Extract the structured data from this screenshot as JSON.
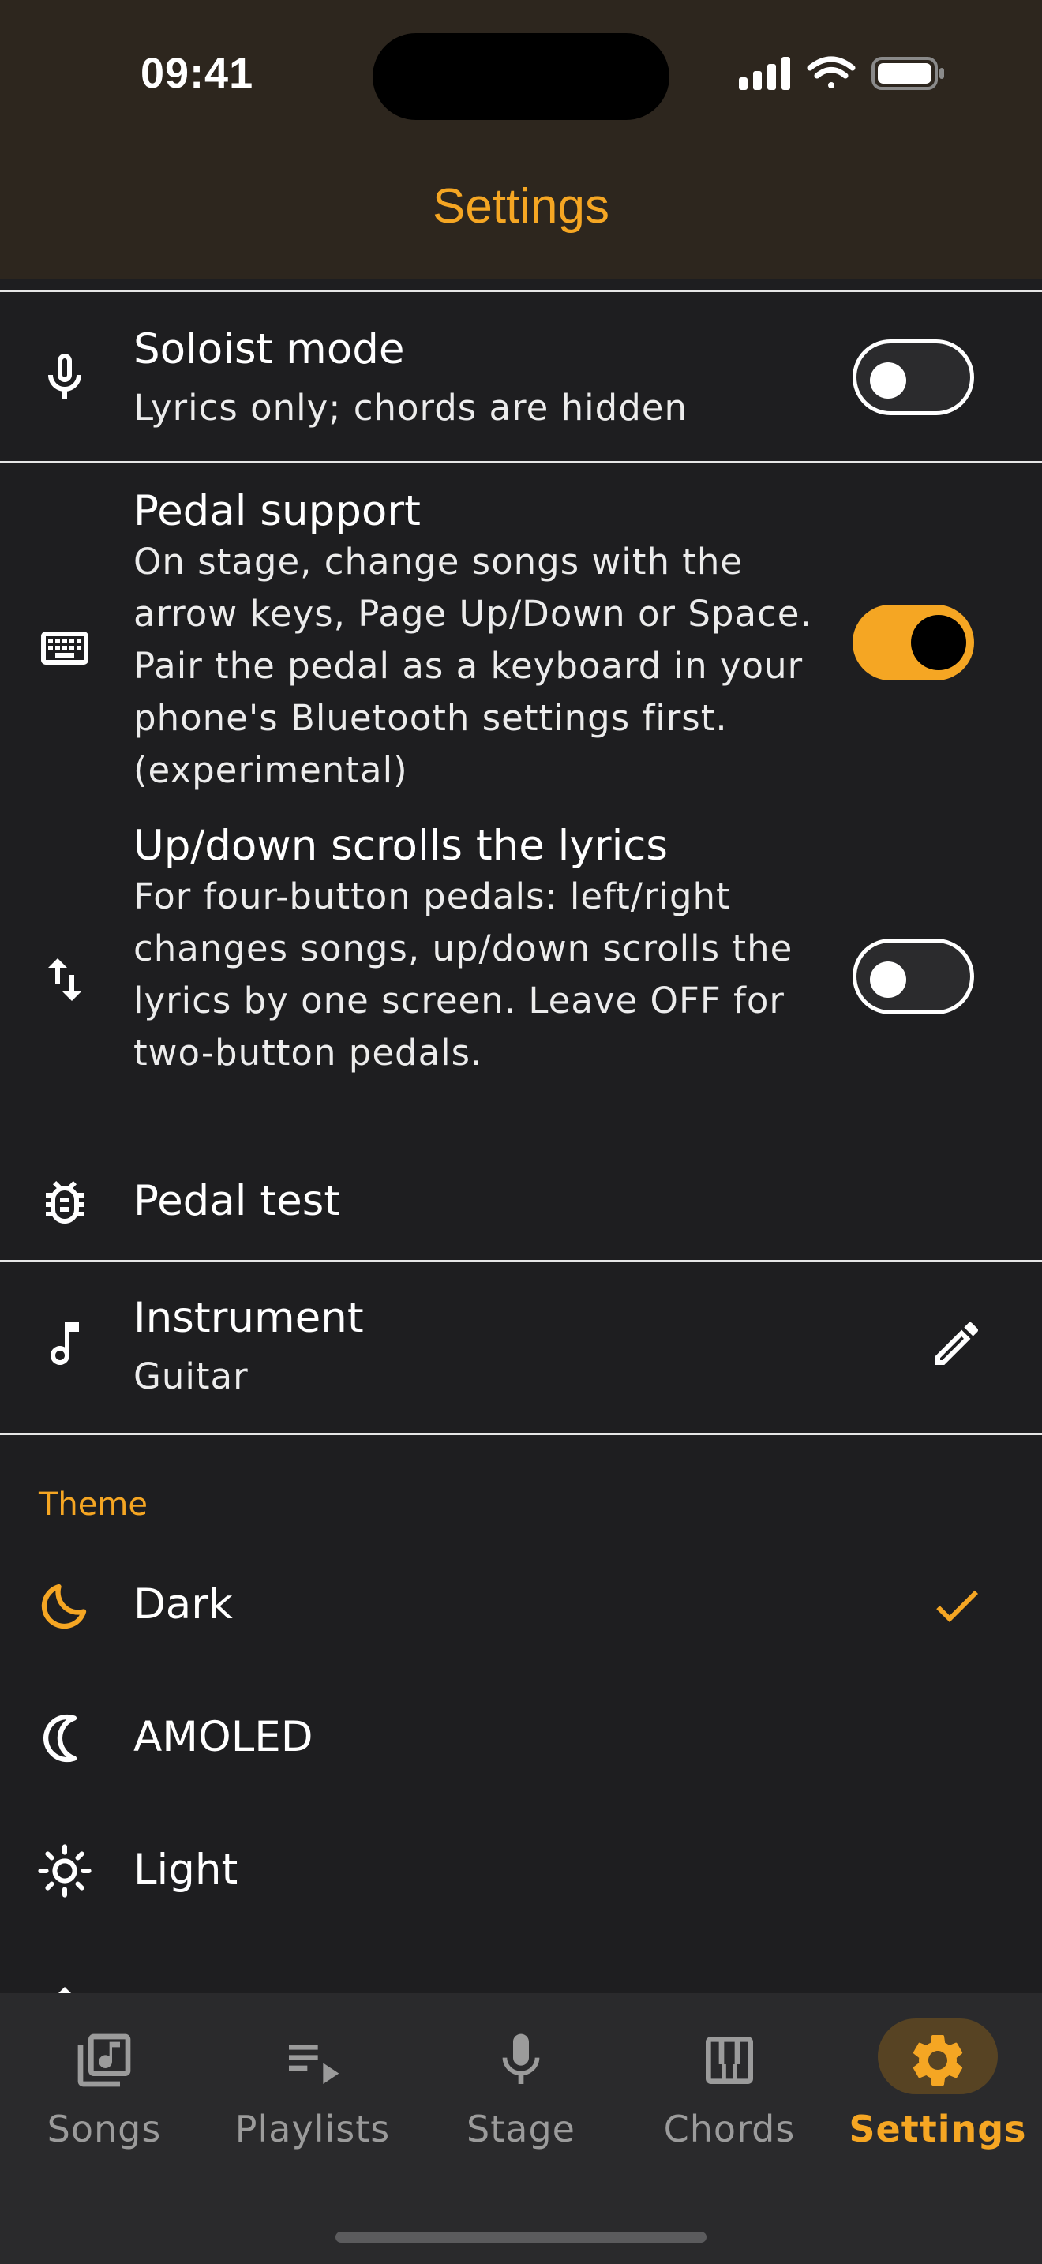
{
  "status_bar": {
    "time": "09:41"
  },
  "header": {
    "title": "Settings"
  },
  "settings": {
    "soloist": {
      "title": "Soloist mode",
      "subtitle": "Lyrics only; chords are hidden",
      "enabled": false
    },
    "pedal_support": {
      "title": "Pedal support",
      "subtitle": "On stage, change songs with the arrow keys, Page Up/Down or Space. Pair the pedal as a keyboard in your phone's Bluetooth settings first. (experimental)",
      "enabled": true
    },
    "updown_scroll": {
      "title": "Up/down scrolls the lyrics",
      "subtitle": "For four-button pedals: left/right changes songs, up/down scrolls the lyrics by one screen. Leave OFF for two-button pedals.",
      "enabled": false
    },
    "pedal_test": {
      "title": "Pedal test"
    },
    "instrument": {
      "title": "Instrument",
      "value": "Guitar"
    },
    "theme": {
      "label": "Theme",
      "options": [
        {
          "label": "Dark",
          "icon": "moon-icon",
          "selected": true
        },
        {
          "label": "AMOLED",
          "icon": "moon-outline-icon",
          "selected": false
        },
        {
          "label": "Light",
          "icon": "sun-icon",
          "selected": false
        }
      ]
    }
  },
  "bottom_nav": {
    "items": [
      {
        "label": "Songs",
        "icon": "library-music-icon",
        "active": false
      },
      {
        "label": "Playlists",
        "icon": "playlist-play-icon",
        "active": false
      },
      {
        "label": "Stage",
        "icon": "mic-icon",
        "active": false
      },
      {
        "label": "Chords",
        "icon": "piano-icon",
        "active": false
      },
      {
        "label": "Settings",
        "icon": "gear-icon",
        "active": true
      }
    ]
  },
  "colors": {
    "accent": "#f5a623",
    "background": "#1e1e20",
    "header": "#2d261e",
    "nav": "#2a2a2c"
  }
}
